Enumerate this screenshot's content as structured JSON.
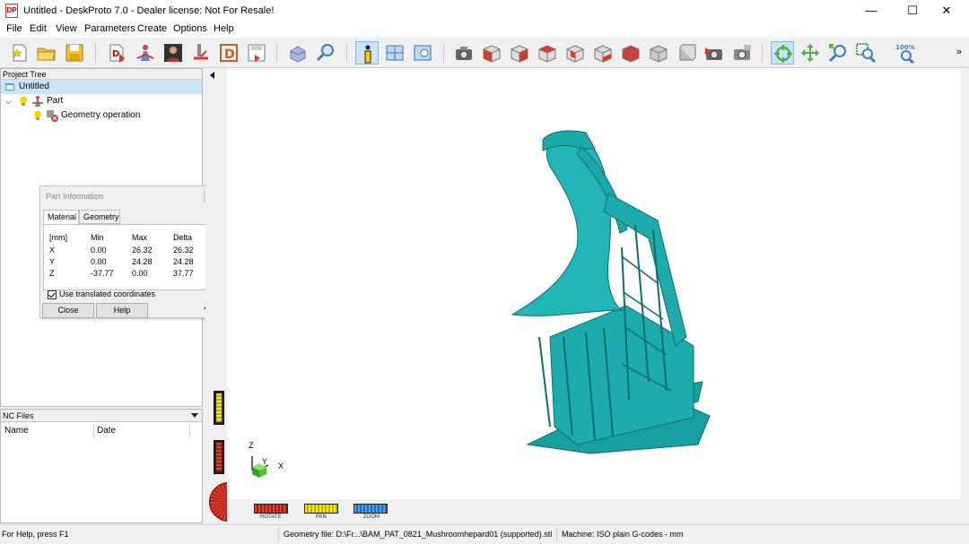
{
  "window": {
    "app_icon": "DP",
    "title": "Untitled - DeskProto 7.0 - Dealer license: Not For Resale!",
    "minimize": "—",
    "maximize": "☐",
    "close": "✕"
  },
  "menu": [
    "File",
    "Edit",
    "View",
    "Parameters",
    "Create",
    "Options",
    "Help"
  ],
  "toolbar": {
    "zoom_label": "100%",
    "more": "»",
    "icons": [
      "new-file-icon",
      "open-folder-icon",
      "save-icon",
      "import-geometry-icon",
      "part-icon",
      "person-icon",
      "tool-icon",
      "d-icon",
      "export-icon",
      "part-view-icon",
      "inspect-icon",
      "info-icon",
      "layout-icon",
      "view-icon",
      "camera-icon",
      "cube-view-icon",
      "cube-view-icon",
      "cube-view-icon",
      "cube-view-icon",
      "cube-view-icon",
      "cube-view-icon",
      "cube-view-icon",
      "cube-view-icon",
      "camera-icon",
      "camera-icon",
      "rotate-icon",
      "pan-icon",
      "zoom-in-icon",
      "zoom-window-icon",
      "zoom-100-icon"
    ]
  },
  "project_tree": {
    "header": "Project Tree",
    "items": [
      {
        "label": "Untitled"
      },
      {
        "label": "Part"
      },
      {
        "label": "Geometry operation"
      }
    ]
  },
  "nc_files": {
    "header": "NC Files",
    "columns": [
      "Name",
      "Date"
    ]
  },
  "part_info": {
    "title": "Part Information",
    "tabs": [
      "Material",
      "Geometry"
    ],
    "table": {
      "headers": [
        "[mm]",
        "Min",
        "Max",
        "Delta"
      ],
      "rows": [
        [
          "X",
          "0.00",
          "26.32",
          "26.32"
        ],
        [
          "Y",
          "0.00",
          "24.28",
          "24.28"
        ],
        [
          "Z",
          "-37.77",
          "0.00",
          "37.77"
        ]
      ]
    },
    "checkbox": "Use translated coordinates",
    "close_button": "Close",
    "help_button": "Help"
  },
  "viewport": {
    "axis_z": "Z",
    "axis_y": "Y",
    "axis_x": "X",
    "controls": [
      "ROTATE",
      "PAN",
      "ZOOM"
    ],
    "model_color": "#1aa8a8"
  },
  "status": {
    "help": "For Help, press F1",
    "geometry": "Geometry file: D:\\Fr...\\BAM_PAT_0821_Mushroomhepard01 (supported).stl",
    "machine": "Machine: ISO plain G-codes - mm"
  }
}
